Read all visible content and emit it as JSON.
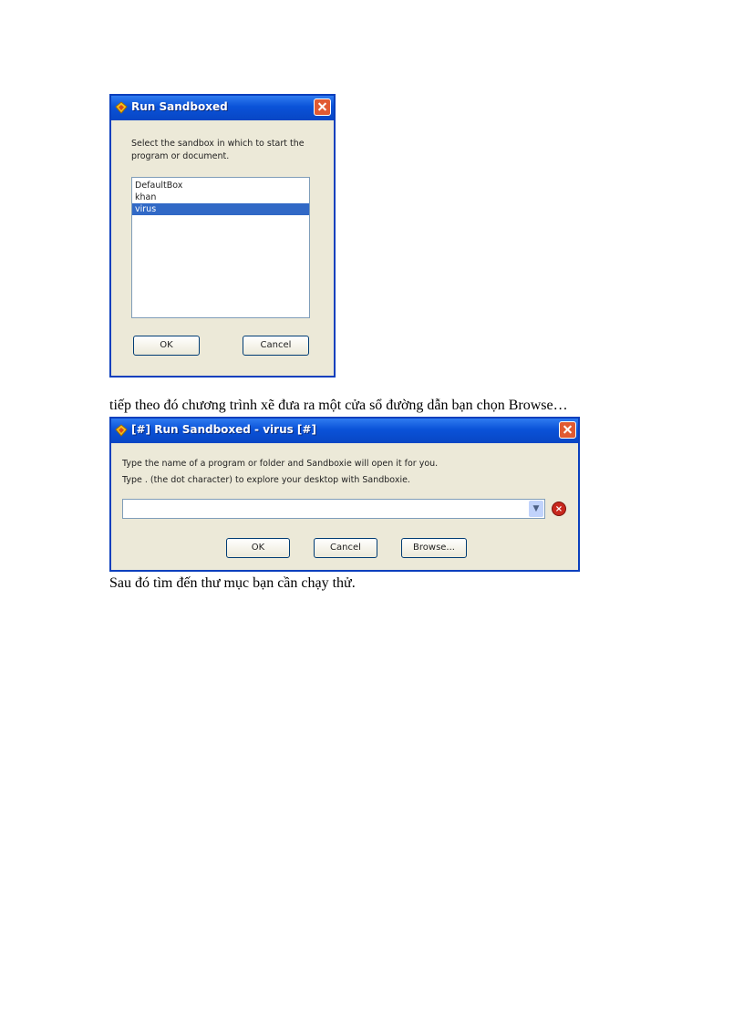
{
  "dialog1": {
    "title": "Run Sandboxed",
    "prompt_line1": "Select the sandbox in which to start the",
    "prompt_line2": "program or document.",
    "sandboxes": [
      "DefaultBox",
      "khan",
      "virus"
    ],
    "selected": "virus",
    "ok_label": "OK",
    "cancel_label": "Cancel"
  },
  "paragraph1": "tiếp theo đó chương trình xẽ đưa ra một cửa sổ đường dẫn bạn chọn Browse…",
  "dialog2": {
    "title": "[#] Run Sandboxed - virus [#]",
    "line1": "Type the name of a program or folder and Sandboxie will open it for you.",
    "line2": "Type  .  (the dot character) to explore your desktop with Sandboxie.",
    "input_value": "",
    "ok_label": "OK",
    "cancel_label": "Cancel",
    "browse_label": "Browse..."
  },
  "paragraph2": "Sau đó tìm đến thư mục bạn cần chạy thử."
}
